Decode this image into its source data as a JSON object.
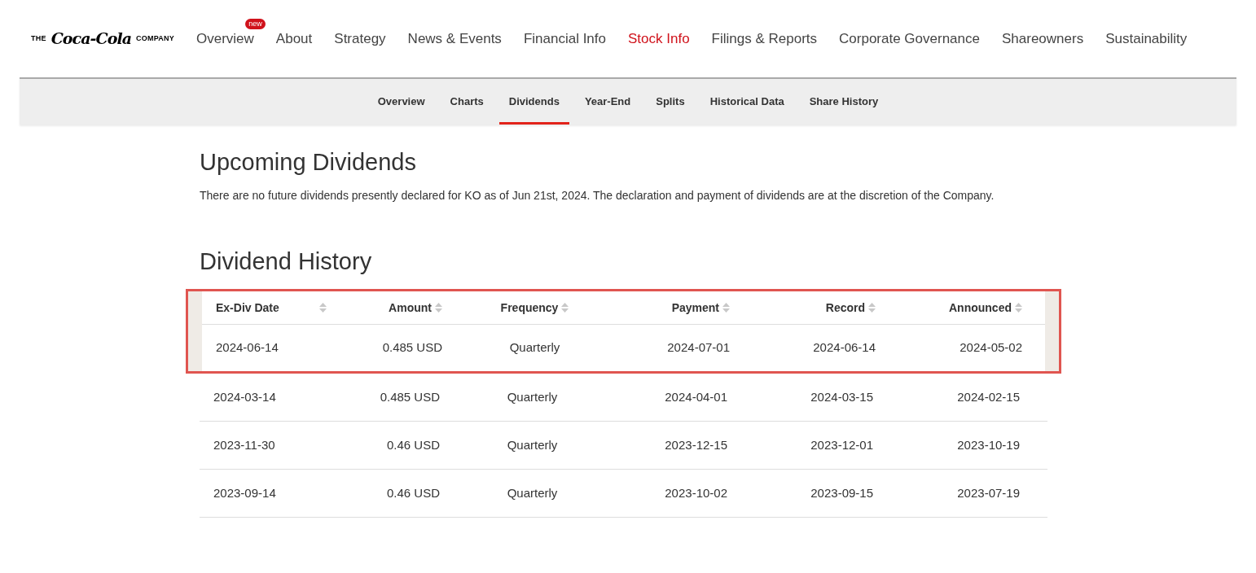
{
  "logo": {
    "prefix": "THE",
    "brand": "Coca-Cola",
    "suffix": "COMPANY"
  },
  "main_nav": [
    {
      "label": "Overview",
      "selected": false,
      "badge": "new"
    },
    {
      "label": "About",
      "selected": false
    },
    {
      "label": "Strategy",
      "selected": false
    },
    {
      "label": "News & Events",
      "selected": false
    },
    {
      "label": "Financial Info",
      "selected": false
    },
    {
      "label": "Stock Info",
      "selected": true
    },
    {
      "label": "Filings & Reports",
      "selected": false
    },
    {
      "label": "Corporate Governance",
      "selected": false
    },
    {
      "label": "Shareowners",
      "selected": false
    },
    {
      "label": "Sustainability",
      "selected": false
    }
  ],
  "sub_nav": [
    {
      "label": "Overview",
      "selected": false
    },
    {
      "label": "Charts",
      "selected": false
    },
    {
      "label": "Dividends",
      "selected": true
    },
    {
      "label": "Year-End",
      "selected": false
    },
    {
      "label": "Splits",
      "selected": false
    },
    {
      "label": "Historical Data",
      "selected": false
    },
    {
      "label": "Share History",
      "selected": false
    }
  ],
  "upcoming": {
    "title": "Upcoming Dividends",
    "text": "There are no future dividends presently declared for KO as of Jun 21st, 2024. The declaration and payment of dividends are at the discretion of the Company."
  },
  "history": {
    "title": "Dividend History",
    "columns": [
      "Ex-Div Date",
      "Amount",
      "Frequency",
      "Payment",
      "Record",
      "Announced"
    ],
    "rows": [
      {
        "cells": [
          "2024-06-14",
          "0.485 USD",
          "Quarterly",
          "2024-07-01",
          "2024-06-14",
          "2024-05-02"
        ],
        "highlighted": true
      },
      {
        "cells": [
          "2024-03-14",
          "0.485 USD",
          "Quarterly",
          "2024-04-01",
          "2024-03-15",
          "2024-02-15"
        ],
        "highlighted": false
      },
      {
        "cells": [
          "2023-11-30",
          "0.46 USD",
          "Quarterly",
          "2023-12-15",
          "2023-12-01",
          "2023-10-19"
        ],
        "highlighted": false
      },
      {
        "cells": [
          "2023-09-14",
          "0.46 USD",
          "Quarterly",
          "2023-10-02",
          "2023-09-15",
          "2023-07-19"
        ],
        "highlighted": false
      }
    ]
  }
}
